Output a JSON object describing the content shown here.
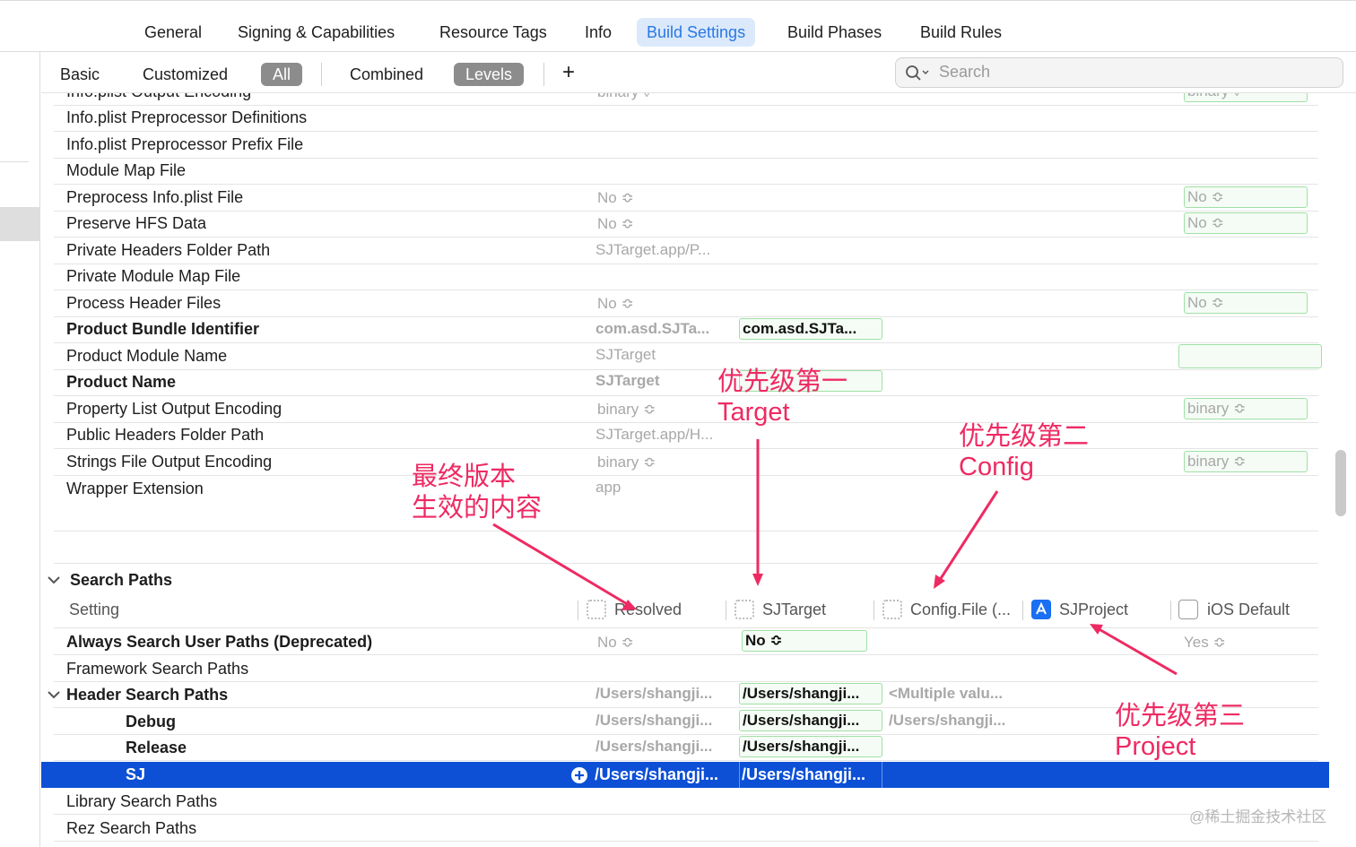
{
  "tabs": [
    "General",
    "Signing & Capabilities",
    "Resource Tags",
    "Info",
    "Build Settings",
    "Build Phases",
    "Build Rules"
  ],
  "filters": {
    "basic": "Basic",
    "customized": "Customized",
    "all": "All",
    "combined": "Combined",
    "levels": "Levels",
    "add": "+"
  },
  "search": {
    "placeholder": "Search"
  },
  "rows_top": {
    "cut_label": "Info.plist Output Encoding",
    "cut_resolved": "binary ◊",
    "cut_default": "binary ◊",
    "r1": "Info.plist Preprocessor Definitions",
    "r2": "Info.plist Preprocessor Prefix File",
    "r3": "Module Map File",
    "r4": "Preprocess Info.plist File",
    "r4_resolved": "No ≎",
    "r4_default": "No ≎",
    "r5": "Preserve HFS Data",
    "r5_resolved": "No ≎",
    "r5_default": "No ≎",
    "r6": "Private Headers Folder Path",
    "r6_resolved": "SJTarget.app/P...",
    "r7": "Private Module Map File",
    "r8": "Process Header Files",
    "r8_resolved": "No ≎",
    "r8_default": "No ≎",
    "r9": "Product Bundle Identifier",
    "r9_resolved": "com.asd.SJTa...",
    "r9_target": "com.asd.SJTa...",
    "r10": "Product Module Name",
    "r10_resolved": "SJTarget",
    "r11": "Product Name",
    "r11_resolved": "SJTarget",
    "r12": "Property List Output Encoding",
    "r12_resolved": "binary ≎",
    "r12_default": "binary ≎",
    "r13": "Public Headers Folder Path",
    "r13_resolved": "SJTarget.app/H...",
    "r14": "Strings File Output Encoding",
    "r14_resolved": "binary ≎",
    "r14_default": "binary ≎",
    "r15": "Wrapper Extension",
    "r15_resolved": "app"
  },
  "search_paths": {
    "section": "Search Paths",
    "header": {
      "setting": "Setting",
      "resolved": "Resolved",
      "target": "SJTarget",
      "config": "Config.File (...",
      "project": "SJProject",
      "default": "iOS Default"
    },
    "always": "Always Search User Paths (Deprecated)",
    "always_resolved": "No ≎",
    "always_target": "No ≎",
    "always_default": "Yes ≎",
    "framework": "Framework Search Paths",
    "header_paths": "Header Search Paths",
    "hsp_resolved": "/Users/shangji...",
    "hsp_target": "/Users/shangji...",
    "hsp_config": "<Multiple valu...",
    "debug": "Debug",
    "debug_resolved": "/Users/shangji...",
    "debug_target": "/Users/shangji...",
    "debug_config": "/Users/shangji...",
    "release": "Release",
    "release_resolved": "/Users/shangji...",
    "release_target": "/Users/shangji...",
    "sj": "SJ",
    "sj_resolved": "/Users/shangji...",
    "sj_target": "/Users/shangji...",
    "library": "Library Search Paths",
    "rez": "Rez Search Paths"
  },
  "annotations": {
    "final_1": "最终版本",
    "final_2": "生效的内容",
    "target_1": "优先级第一",
    "target_2": "Target",
    "config_1": "优先级第二",
    "config_2": "Config",
    "project_1": "优先级第三",
    "project_2": "Project"
  },
  "watermark": "@稀土掘金技术社区",
  "colors": {
    "accent": "#2a78e4",
    "selection": "#0d50d6",
    "annotation": "#ee2a63",
    "level_box": "#9fe0a5"
  }
}
